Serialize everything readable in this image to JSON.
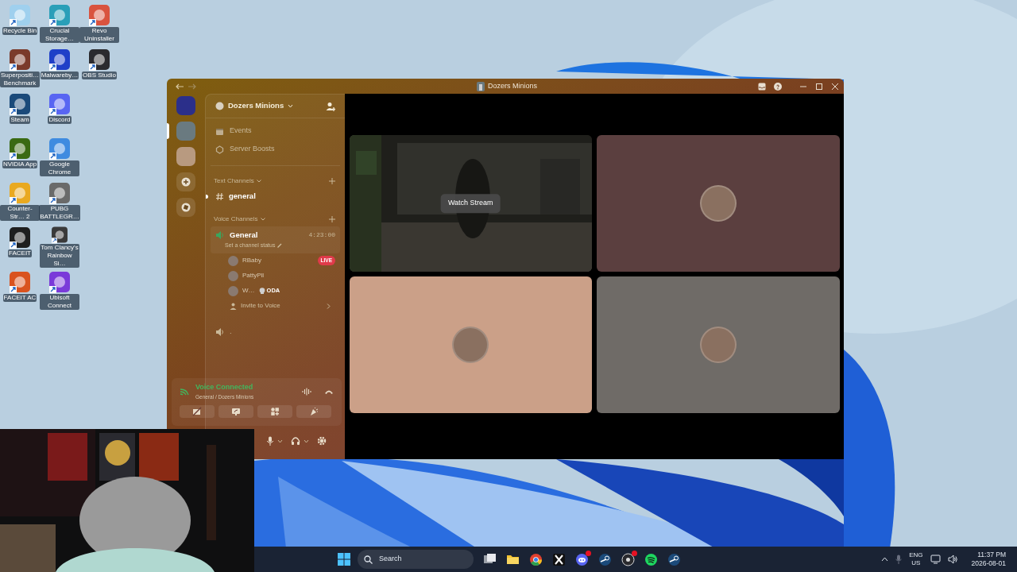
{
  "desktop_icon_rows": [
    [
      {
        "label": "Recycle Bin",
        "color": "#9fd0ee"
      },
      {
        "label": "Crucial Storage…",
        "color": "#2a9fb8"
      },
      {
        "label": "Revo Uninstaller",
        "color": "#d9533f"
      }
    ],
    [
      {
        "label": "Superpositi… Benchmark",
        "color": "#7a3a2a"
      },
      {
        "label": "Malwareby…",
        "color": "#1f3fc8"
      },
      {
        "label": "OBS Studio",
        "color": "#2a2a2e"
      }
    ],
    [
      {
        "label": "Steam",
        "color": "#1b4a7a"
      },
      {
        "label": "Discord",
        "color": "#5865f2"
      }
    ],
    [
      {
        "label": "NVIDIA App",
        "color": "#3a6a12"
      },
      {
        "label": "Google Chrome",
        "color": "#3f8be0"
      }
    ],
    [
      {
        "label": "Counter-Str… 2",
        "color": "#e9a920"
      },
      {
        "label": "PUBG BATTLEGR…",
        "color": "#6a6a6a"
      }
    ],
    [
      {
        "label": "FACEIT",
        "color": "#1e1e1e"
      },
      {
        "label": "Tom Clancy's Rainbow Si…",
        "color": "#3a3a3a"
      }
    ],
    [
      {
        "label": "FACEIT AC",
        "color": "#d9531f"
      },
      {
        "label": "Ubisoft Connect",
        "color": "#7a3ad9"
      }
    ]
  ],
  "window": {
    "title": "Dozers Minions"
  },
  "servers": [
    {
      "kind": "server",
      "selected": false,
      "color": "#2b2f8a"
    },
    {
      "kind": "server",
      "selected": true,
      "color": "#6a7a80"
    },
    {
      "kind": "server",
      "selected": false,
      "color": "#b89a80"
    },
    {
      "kind": "add",
      "selected": false
    },
    {
      "kind": "discover",
      "selected": false
    }
  ],
  "server_name": "Dozers Minions",
  "nav_items": [
    {
      "kind": "events",
      "label": "Events"
    },
    {
      "kind": "boosts",
      "label": "Server Boosts"
    }
  ],
  "text_category": "Text Channels",
  "text_channels": [
    {
      "name": "general",
      "unread": true
    }
  ],
  "voice_category": "Voice Channels",
  "voice_channels": [
    {
      "name": "General",
      "connected": true,
      "timer": "4:23:00",
      "status": "Set a channel status",
      "members": [
        {
          "name": "RBaby",
          "badge": "LIVE"
        },
        {
          "name": "PattyPll"
        },
        {
          "name": "W…",
          "tag": "ODA"
        }
      ],
      "invite": "Invite to Voice"
    },
    {
      "name": ".",
      "connected": false
    }
  ],
  "voice_panel": {
    "title": "Voice Connected",
    "subtitle": "General / Dozers Minions"
  },
  "tiles": [
    {
      "kind": "stream",
      "label": "Watch Stream"
    },
    {
      "kind": "avatar",
      "color": "#5b3f3f"
    },
    {
      "kind": "avatar",
      "color": "#cba088"
    },
    {
      "kind": "avatar",
      "color": "#6f6b67"
    }
  ],
  "taskbar": {
    "search": "Search",
    "apps": [
      {
        "kind": "taskview",
        "badge": false
      },
      {
        "kind": "folder",
        "badge": false
      },
      {
        "kind": "chrome",
        "badge": false
      },
      {
        "kind": "x",
        "badge": false
      },
      {
        "kind": "discord",
        "badge": true
      },
      {
        "kind": "steam",
        "badge": false
      },
      {
        "kind": "obs",
        "badge": true
      },
      {
        "kind": "spotify",
        "badge": false
      },
      {
        "kind": "steam",
        "badge": false
      }
    ],
    "language": "ENG",
    "region": "US",
    "time": "11:37 PM",
    "date": "2026-08-01"
  }
}
